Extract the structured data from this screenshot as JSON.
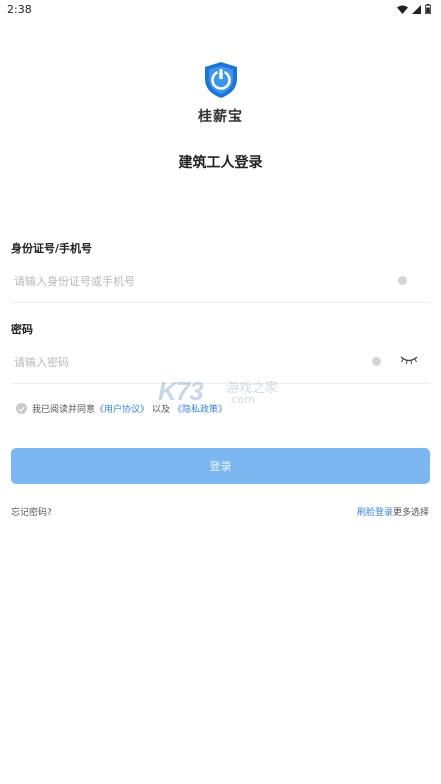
{
  "status_bar": {
    "time": "2:38",
    "icons": [
      "wifi-icon",
      "cellular-signal-icon",
      "battery-icon"
    ]
  },
  "app": {
    "logo_text": "桂薪宝",
    "logo_icon": "shield-wrench-icon",
    "brand_color": "#1e74d6"
  },
  "page": {
    "title": "建筑工人登录"
  },
  "form": {
    "id_label": "身份证号/手机号",
    "id_placeholder": "请输入身份证号或手机号",
    "id_value": "",
    "password_label": "密码",
    "password_placeholder": "请输入密码",
    "password_value": ""
  },
  "agreement": {
    "prefix": "我已阅读并同意",
    "user_agreement": "《用户协议》",
    "and": "以及",
    "privacy_policy": "《隐私政策》",
    "checked": false
  },
  "actions": {
    "login_label": "登录",
    "login_color": "#7db7f2",
    "forgot_password": "忘记密码?",
    "face_login": "刷脸登录",
    "more_options": "更多选择"
  },
  "watermark": {
    "brand": "K73",
    "cn": "游戏之家",
    "domain": ".com"
  }
}
